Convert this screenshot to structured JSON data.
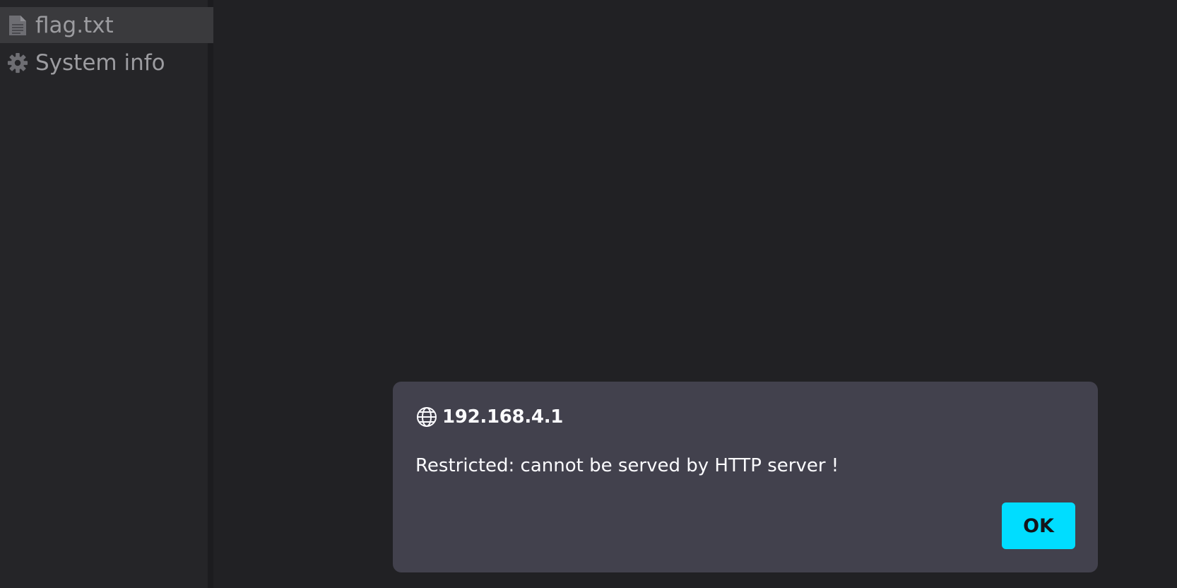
{
  "sidebar": {
    "items": [
      {
        "label": "flag.txt",
        "icon": "file-icon",
        "selected": true
      },
      {
        "label": "System info",
        "icon": "gear-icon",
        "selected": false
      }
    ]
  },
  "dialog": {
    "title": "192.168.4.1",
    "message": "Restricted: cannot be served by HTTP server !",
    "ok_label": "OK",
    "icon": "globe-icon"
  },
  "colors": {
    "background": "#212124",
    "sidebar": "#252528",
    "selected_item": "#3a3a3d",
    "dialog": "#42414d",
    "accent": "#00ddff"
  }
}
